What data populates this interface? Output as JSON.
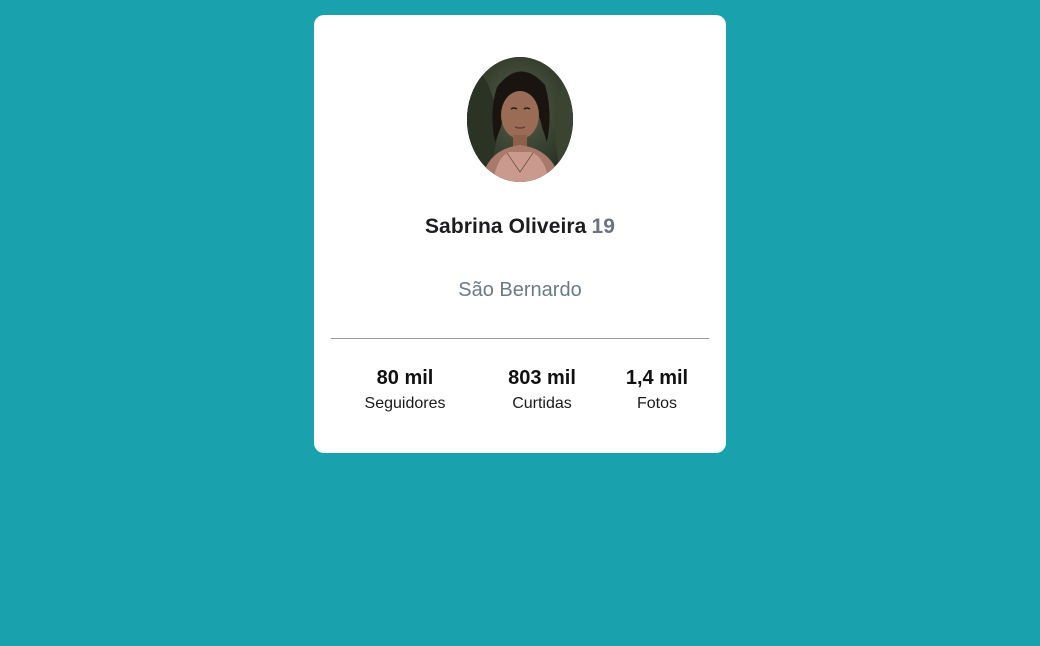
{
  "profile": {
    "name": "Sabrina Oliveira",
    "age": "19",
    "city": "São Bernardo"
  },
  "stats": [
    {
      "value": "80 mil",
      "label": "Seguidores"
    },
    {
      "value": "803 mil",
      "label": "Curtidas"
    },
    {
      "value": "1,4 mil",
      "label": "Fotos"
    }
  ],
  "colors": {
    "background": "#19a1ae",
    "card": "#ffffff",
    "muted_text": "#6b7a86"
  }
}
